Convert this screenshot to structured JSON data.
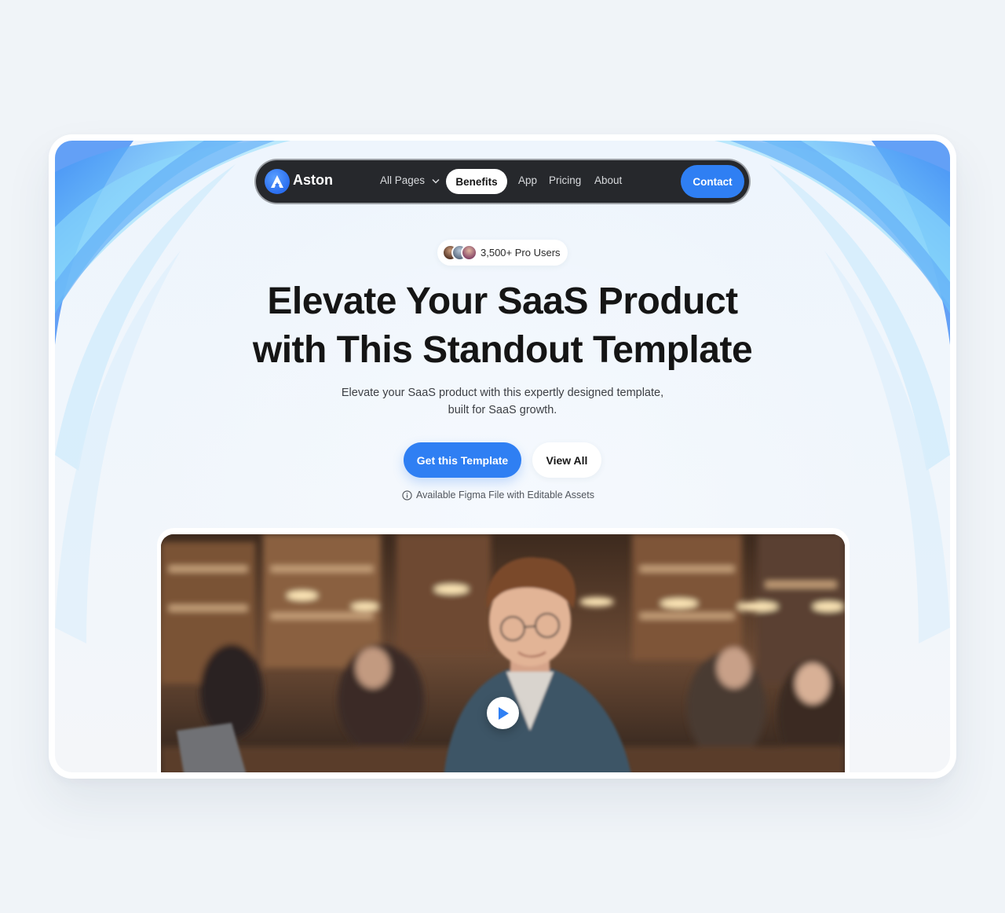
{
  "brand": {
    "name": "Aston",
    "accent": "#2f7ff3",
    "nav_bg": "#26282c"
  },
  "nav": {
    "items": [
      {
        "label": "All Pages",
        "icon": "chevron-down-icon"
      },
      {
        "label": "Benefits",
        "active": true
      },
      {
        "label": "App"
      },
      {
        "label": "Pricing"
      },
      {
        "label": "About"
      }
    ],
    "cta_label": "Contact"
  },
  "badge": {
    "text": "3,500+ Pro Users",
    "avatars": [
      "avatar-1",
      "avatar-2",
      "avatar-3"
    ]
  },
  "hero": {
    "headline_line1": "Elevate Your SaaS Product",
    "headline_line2": "with This Standout Template",
    "subtitle_line1": "Elevate your SaaS product with this expertly designed template,",
    "subtitle_line2": "built for SaaS growth.",
    "primary_cta": "Get this Template",
    "secondary_cta": "View All",
    "note": "Available Figma File with Editable Assets",
    "note_icon": "info-icon"
  },
  "video": {
    "play_icon": "play-icon"
  }
}
